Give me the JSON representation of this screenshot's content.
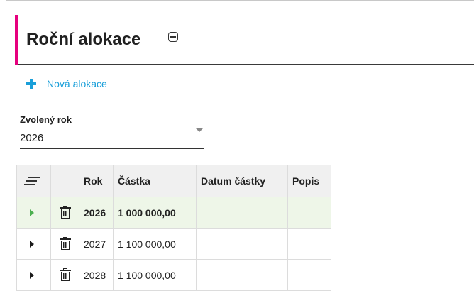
{
  "header": {
    "title": "Roční alokace",
    "collapse_icon": "collapse-square-icon",
    "accent_color": "#e6007e"
  },
  "toolbar": {
    "add_label": "Nová alokace",
    "add_icon": "plus-icon",
    "add_color": "#1a9fd9"
  },
  "year_select": {
    "label": "Zvolený rok",
    "value": "2026"
  },
  "grid": {
    "columns": {
      "rok": "Rok",
      "castka": "Částka",
      "datum": "Datum částky",
      "popis": "Popis"
    },
    "rows": [
      {
        "rok": "2026",
        "castka": "1 000 000,00",
        "datum": "",
        "popis": "",
        "selected": true
      },
      {
        "rok": "2027",
        "castka": "1 100 000,00",
        "datum": "",
        "popis": "",
        "selected": false
      },
      {
        "rok": "2028",
        "castka": "1 100 000,00",
        "datum": "",
        "popis": "",
        "selected": false
      }
    ],
    "selected_row_color": "#eef6e8"
  }
}
